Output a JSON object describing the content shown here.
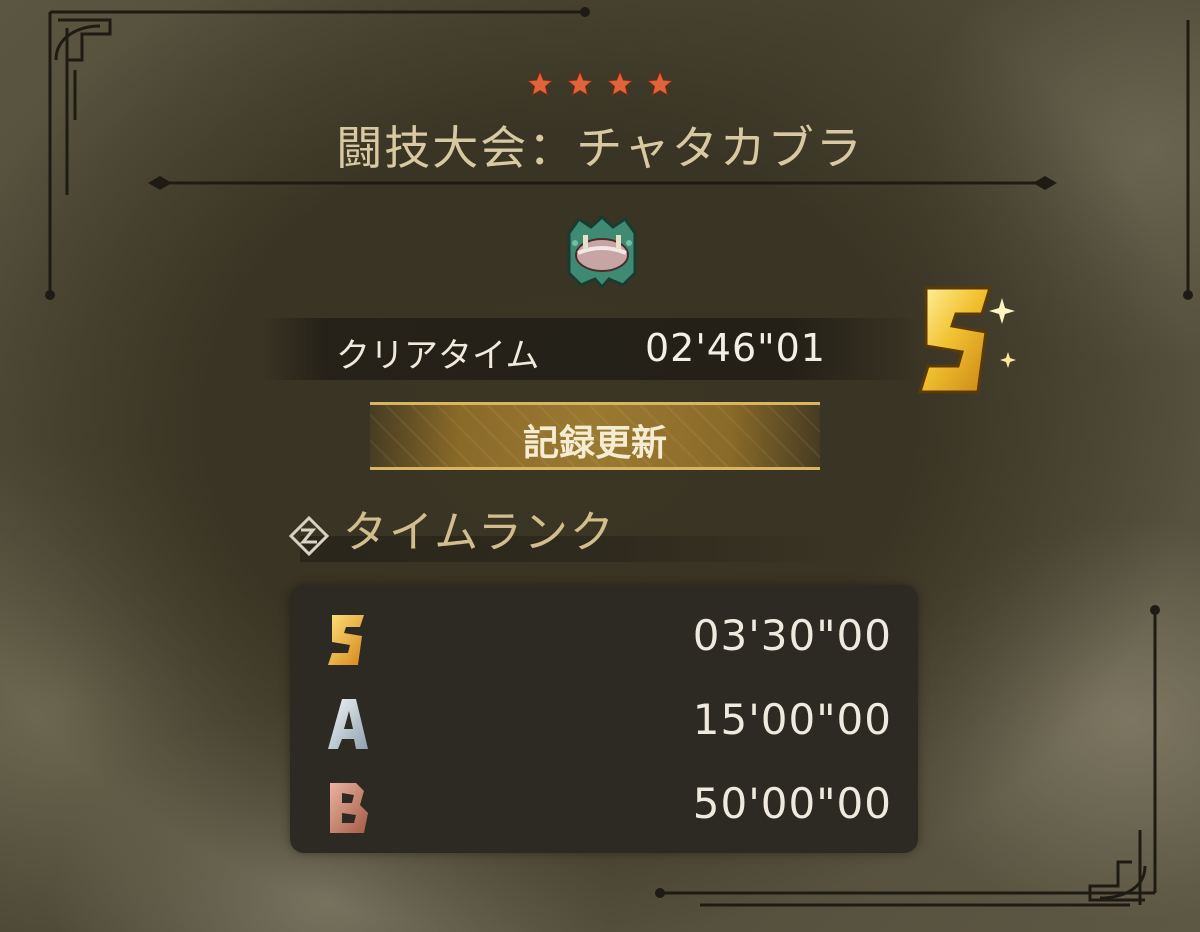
{
  "quest": {
    "star_count": 4,
    "title": "闘技大会：チャタカブラ",
    "star_color": "#e0643a"
  },
  "result": {
    "clear_label": "クリアタイム",
    "clear_time": "02'46\"01",
    "achieved_rank": "S",
    "record_label": "記録更新"
  },
  "time_rank": {
    "title": "タイムランク",
    "rows": [
      {
        "rank": "S",
        "time": "03'30\"00",
        "color": "#e6a630"
      },
      {
        "rank": "A",
        "time": "15'00\"00",
        "color": "#b9c4cc"
      },
      {
        "rank": "B",
        "time": "50'00\"00",
        "color": "#c07a64"
      }
    ]
  },
  "icons": {
    "monster": "chatacabra-monster-icon",
    "time_rank": "time-rank-icon",
    "star": "star-icon"
  }
}
